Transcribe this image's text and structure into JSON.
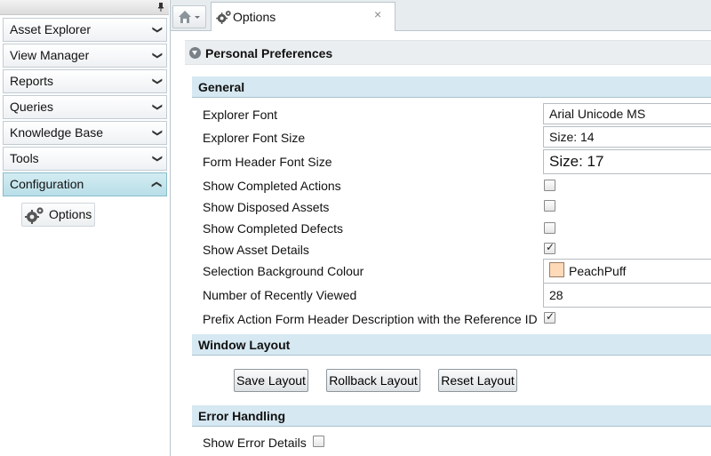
{
  "nav": {
    "items": [
      {
        "label": "Asset Explorer"
      },
      {
        "label": "View Manager"
      },
      {
        "label": "Reports"
      },
      {
        "label": "Queries"
      },
      {
        "label": "Knowledge Base"
      },
      {
        "label": "Tools"
      },
      {
        "label": "Configuration"
      }
    ],
    "sub_option_label": "Options"
  },
  "tabs": {
    "options_label": "Options",
    "close_glyph": "×"
  },
  "page": {
    "section_title": "Personal Preferences",
    "general": {
      "header": "General",
      "labels": {
        "explorer_font": "Explorer Font",
        "explorer_font_size": "Explorer Font Size",
        "form_header_font_size": "Form Header Font Size",
        "show_completed_actions": "Show Completed Actions",
        "show_disposed_assets": "Show Disposed Assets",
        "show_completed_defects": "Show Completed Defects",
        "show_asset_details": "Show Asset Details",
        "selection_background_colour": "Selection Background Colour",
        "number_recently_viewed": "Number of Recently Viewed",
        "prefix_action_form": "Prefix Action Form Header Description with the Reference ID"
      },
      "values": {
        "explorer_font": "Arial Unicode MS",
        "explorer_font_size": "Size: 14",
        "form_header_font_size": "Size: 17",
        "selection_background_colour": "PeachPuff",
        "number_recently_viewed": "28"
      },
      "checked": {
        "show_completed_actions": false,
        "show_disposed_assets": false,
        "show_completed_defects": false,
        "show_asset_details": true,
        "prefix_action_form": true
      },
      "swatch_color": "#FFDAB9"
    },
    "window_layout": {
      "header": "Window Layout",
      "save": "Save Layout",
      "rollback": "Rollback Layout",
      "reset": "Reset Layout"
    },
    "error_handling": {
      "header": "Error Handling",
      "show_error_details": "Show Error Details",
      "show_error_details_checked": false
    }
  },
  "colors": {
    "active_nav": "#B8DEE8",
    "section_header": "#D6E8F1"
  }
}
